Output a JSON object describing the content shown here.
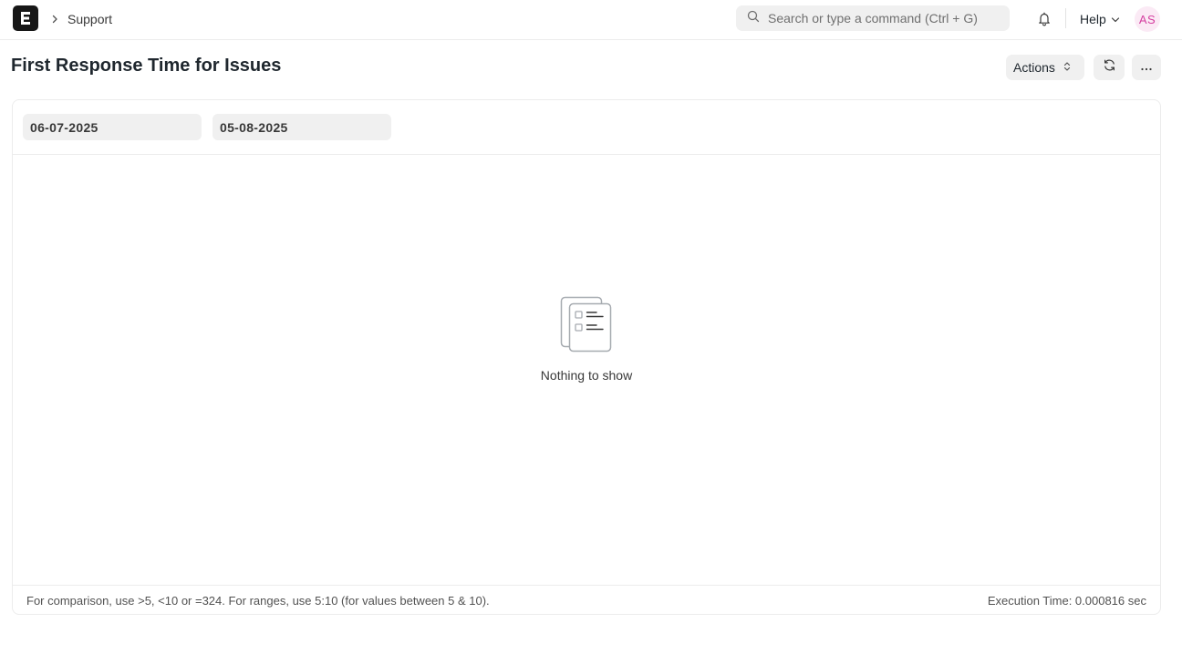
{
  "navbar": {
    "logo_letter": "E",
    "breadcrumb": {
      "module": "Support"
    },
    "search": {
      "placeholder": "Search or type a command (Ctrl + G)"
    },
    "help_label": "Help",
    "avatar_initials": "AS"
  },
  "page": {
    "title": "First Response Time for Issues",
    "actions_label": "Actions"
  },
  "filters": {
    "from_date": "06-07-2025",
    "to_date": "05-08-2025"
  },
  "report": {
    "empty_message": "Nothing to show",
    "footer_hint": "For comparison, use >5, <10 or =324. For ranges, use 5:10 (for values between 5 & 10).",
    "execution_time": "Execution Time: 0.000816 sec"
  },
  "colors": {
    "accent_avatar": "#d53fa0",
    "logo_bg": "#171717",
    "button_bg": "#f0f0f0"
  },
  "icons": [
    "app-logo-icon",
    "chevron-right-icon",
    "search-icon",
    "bell-icon",
    "chevron-down-icon",
    "sort-icon",
    "refresh-icon",
    "more-horizontal-icon",
    "empty-list-icon"
  ]
}
